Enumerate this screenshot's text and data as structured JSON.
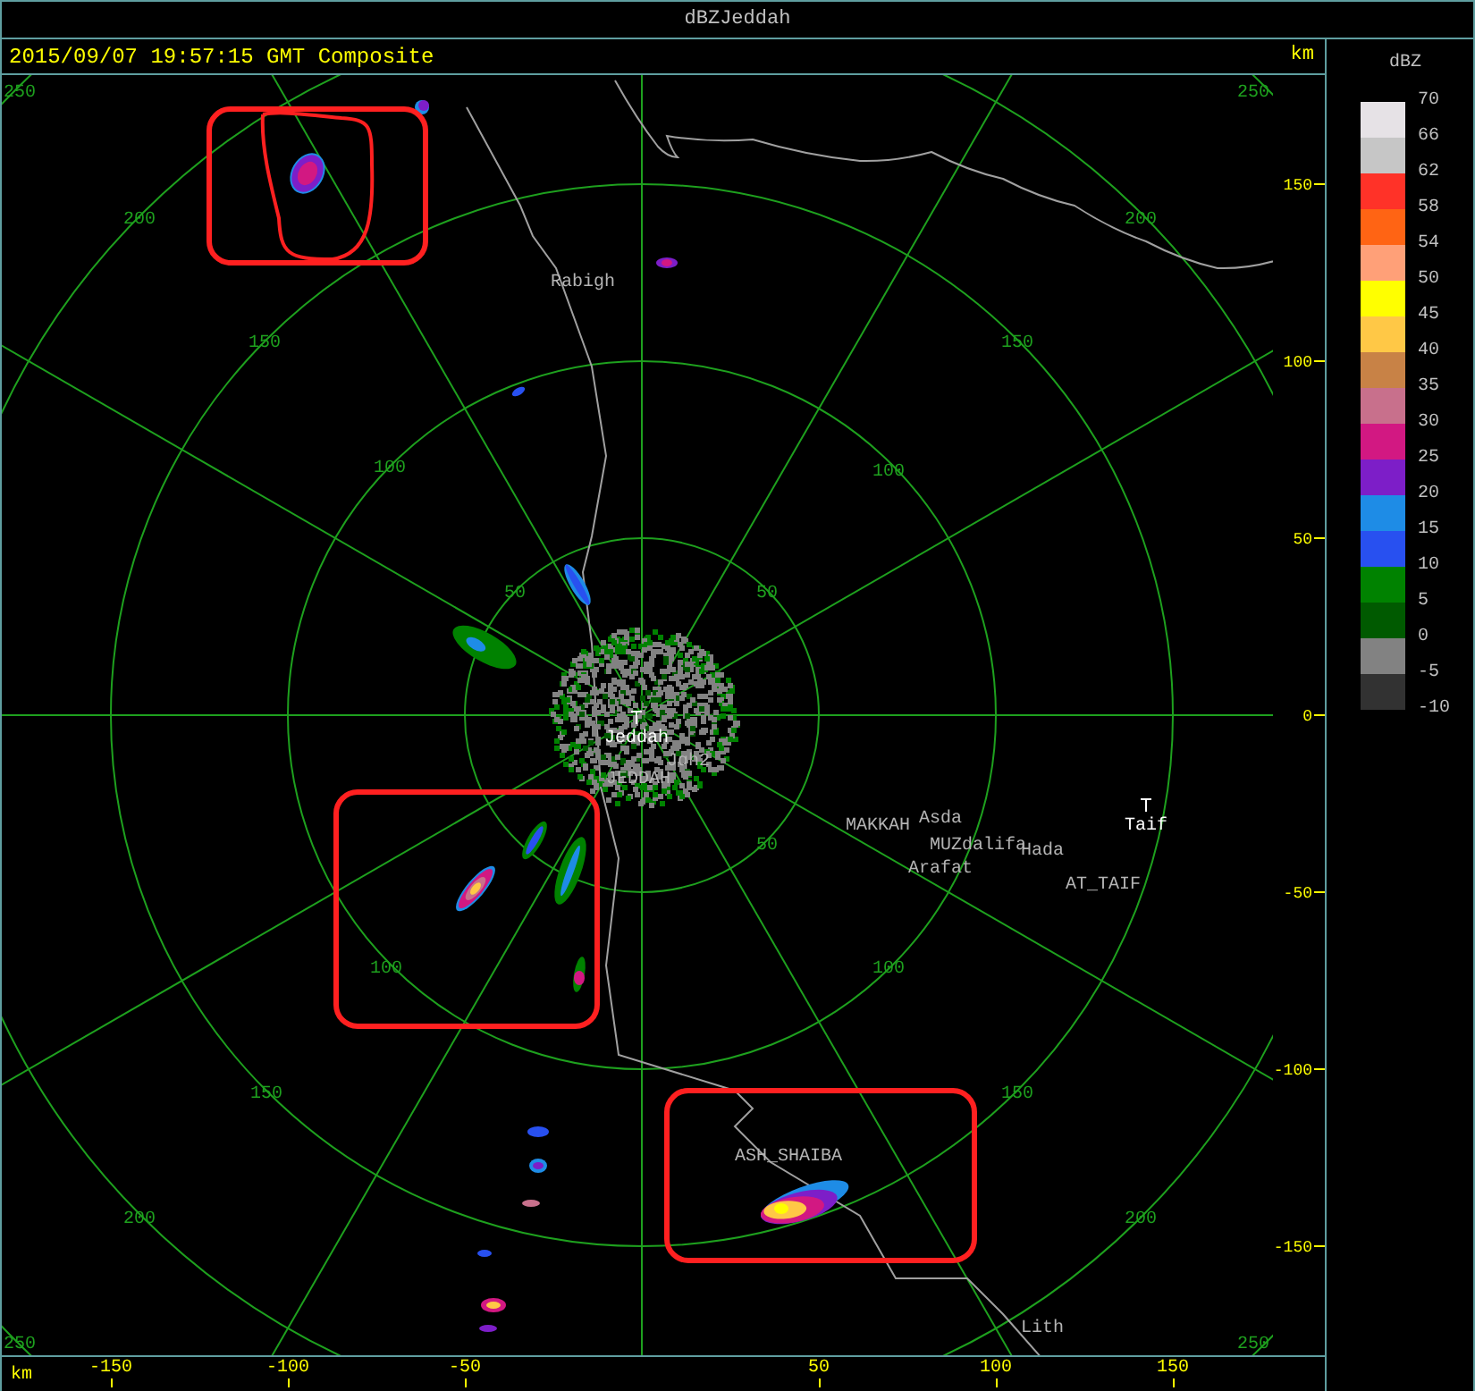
{
  "window": {
    "title": "dBZJeddah"
  },
  "header": {
    "timestamp": "2015/09/07 19:57:15 GMT Composite",
    "unit": "km"
  },
  "plot": {
    "ring_labels": [
      "50",
      "50",
      "50",
      "100",
      "100",
      "100",
      "100",
      "150",
      "150",
      "150",
      "150",
      "200",
      "200",
      "200",
      "200",
      "250",
      "250",
      "250",
      "250"
    ],
    "places": [
      {
        "name": "Rabigh",
        "kind": "city"
      },
      {
        "name": "Jeddah",
        "kind": "radar"
      },
      {
        "name": "Jqh2",
        "kind": "city"
      },
      {
        "name": "JEDDAH",
        "kind": "city"
      },
      {
        "name": "MAKKAH",
        "kind": "city"
      },
      {
        "name": "Asda",
        "kind": "city"
      },
      {
        "name": "MUZdalifa",
        "kind": "city"
      },
      {
        "name": "Arafat",
        "kind": "city"
      },
      {
        "name": "Hada",
        "kind": "city"
      },
      {
        "name": "Taif",
        "kind": "radar"
      },
      {
        "name": "AT_TAIF",
        "kind": "city"
      },
      {
        "name": "ASH_SHAIBA",
        "kind": "city"
      },
      {
        "name": "Lith",
        "kind": "city"
      }
    ]
  },
  "y_axis": {
    "ticks": [
      "150",
      "100",
      "50",
      "0",
      "-50",
      "-100",
      "-150"
    ]
  },
  "x_axis": {
    "unit": "km",
    "ticks": [
      "-150",
      "-100",
      "-50",
      "50",
      "100",
      "150"
    ]
  },
  "legend": {
    "unit": "dBZ",
    "labels": [
      "70",
      "66",
      "62",
      "58",
      "54",
      "50",
      "45",
      "40",
      "35",
      "30",
      "25",
      "20",
      "15",
      "10",
      "5",
      "0",
      "-5",
      "-10"
    ],
    "bands": [
      {
        "color": "#e6e2e6"
      },
      {
        "color": "#c6c6c6"
      },
      {
        "color": "#ff3228"
      },
      {
        "color": "#ff6414"
      },
      {
        "color": "#ffa078"
      },
      {
        "color": "#ffff00"
      },
      {
        "color": "#ffc846"
      },
      {
        "color": "#c88246"
      },
      {
        "color": "#c8708c"
      },
      {
        "color": "#d21882"
      },
      {
        "color": "#7d1ec8"
      },
      {
        "color": "#1e8ce6"
      },
      {
        "color": "#2850f0"
      },
      {
        "color": "#008200"
      },
      {
        "color": "#005a00"
      },
      {
        "color": "#828282"
      },
      {
        "color": "#323232"
      }
    ]
  }
}
